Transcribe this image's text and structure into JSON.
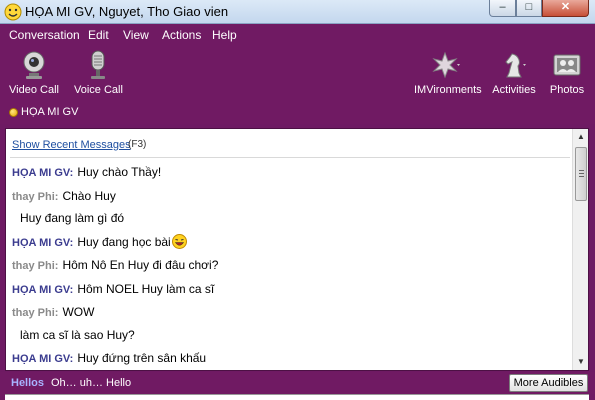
{
  "window": {
    "title": "HỌA MI GV, Nguyet, Tho Giao vien",
    "min_label": "–",
    "max_label": "□",
    "close_label": "✕"
  },
  "menu": [
    "Conversation",
    "Edit",
    "View",
    "Actions",
    "Help"
  ],
  "toolbar": {
    "video_call": "Video Call",
    "voice_call": "Voice Call",
    "imvironments": "IMVironments",
    "activities": "Activities",
    "photos": "Photos"
  },
  "contact": {
    "name": "HỌA MI GV",
    "status_color": "#f0b400"
  },
  "conversation": {
    "show_recent": "Show Recent Messages",
    "shortcut": "(F3)",
    "messages": [
      {
        "sender": "HỌA MI GV:",
        "text": "Huy chào Thầy!"
      },
      {
        "sender": "thay Phi:",
        "text": "Chào Huy"
      },
      {
        "sender": "",
        "text": "Huy đang làm gì đó"
      },
      {
        "sender": "HỌA MI GV:",
        "text": "Huy đang học bài"
      },
      {
        "sender": "thay Phi:",
        "text": "Hôm Nô En Huy đi đâu chơi?"
      },
      {
        "sender": "HỌA MI GV:",
        "text": "Hôm NOEL Huy làm ca sĩ"
      },
      {
        "sender": "thay Phi:",
        "text": "WOW"
      },
      {
        "sender": "",
        "text": "làm ca sĩ là sao Huy?"
      },
      {
        "sender": "HỌA MI GV:",
        "text": "Huy đứng trên sân khấu"
      }
    ]
  },
  "audibles": {
    "label": "Hellos",
    "text": "Oh… uh… Hello",
    "more_button": "More Audibles"
  },
  "colors": {
    "frame": "#701a63",
    "sender_me": "#3b3c8f",
    "sender_them": "#8a8a8a",
    "link": "#1f4fa0"
  }
}
